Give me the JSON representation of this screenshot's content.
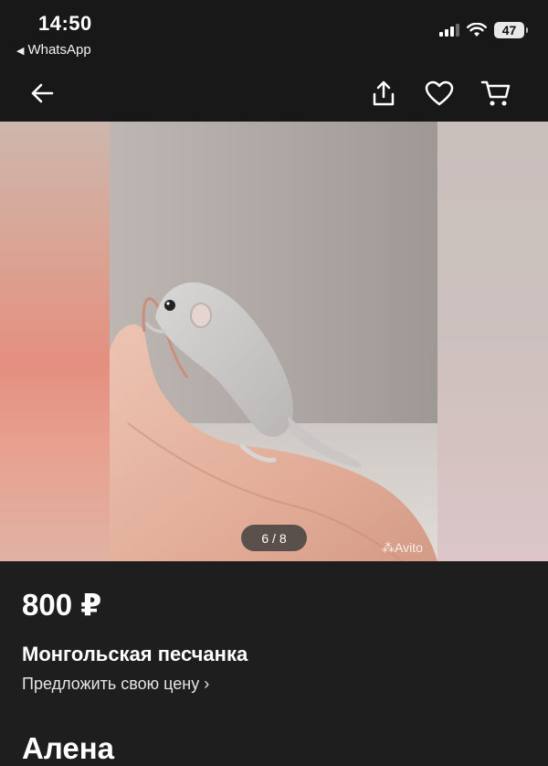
{
  "status": {
    "time": "14:50",
    "back_app": "WhatsApp",
    "battery": "47"
  },
  "nav": {
    "icons": [
      "back-arrow-icon",
      "share-icon",
      "heart-icon",
      "cart-icon"
    ]
  },
  "gallery": {
    "counter": "6 / 8",
    "watermark": "Avito"
  },
  "listing": {
    "price": "800 ₽",
    "title": "Монгольская песчанка",
    "offer_link": "Предложить свою цену",
    "offer_chevron": "›",
    "seller_name": "Алена"
  },
  "colors": {
    "background": "#1e1e1e",
    "bar": "#181818",
    "text": "#ffffff"
  }
}
